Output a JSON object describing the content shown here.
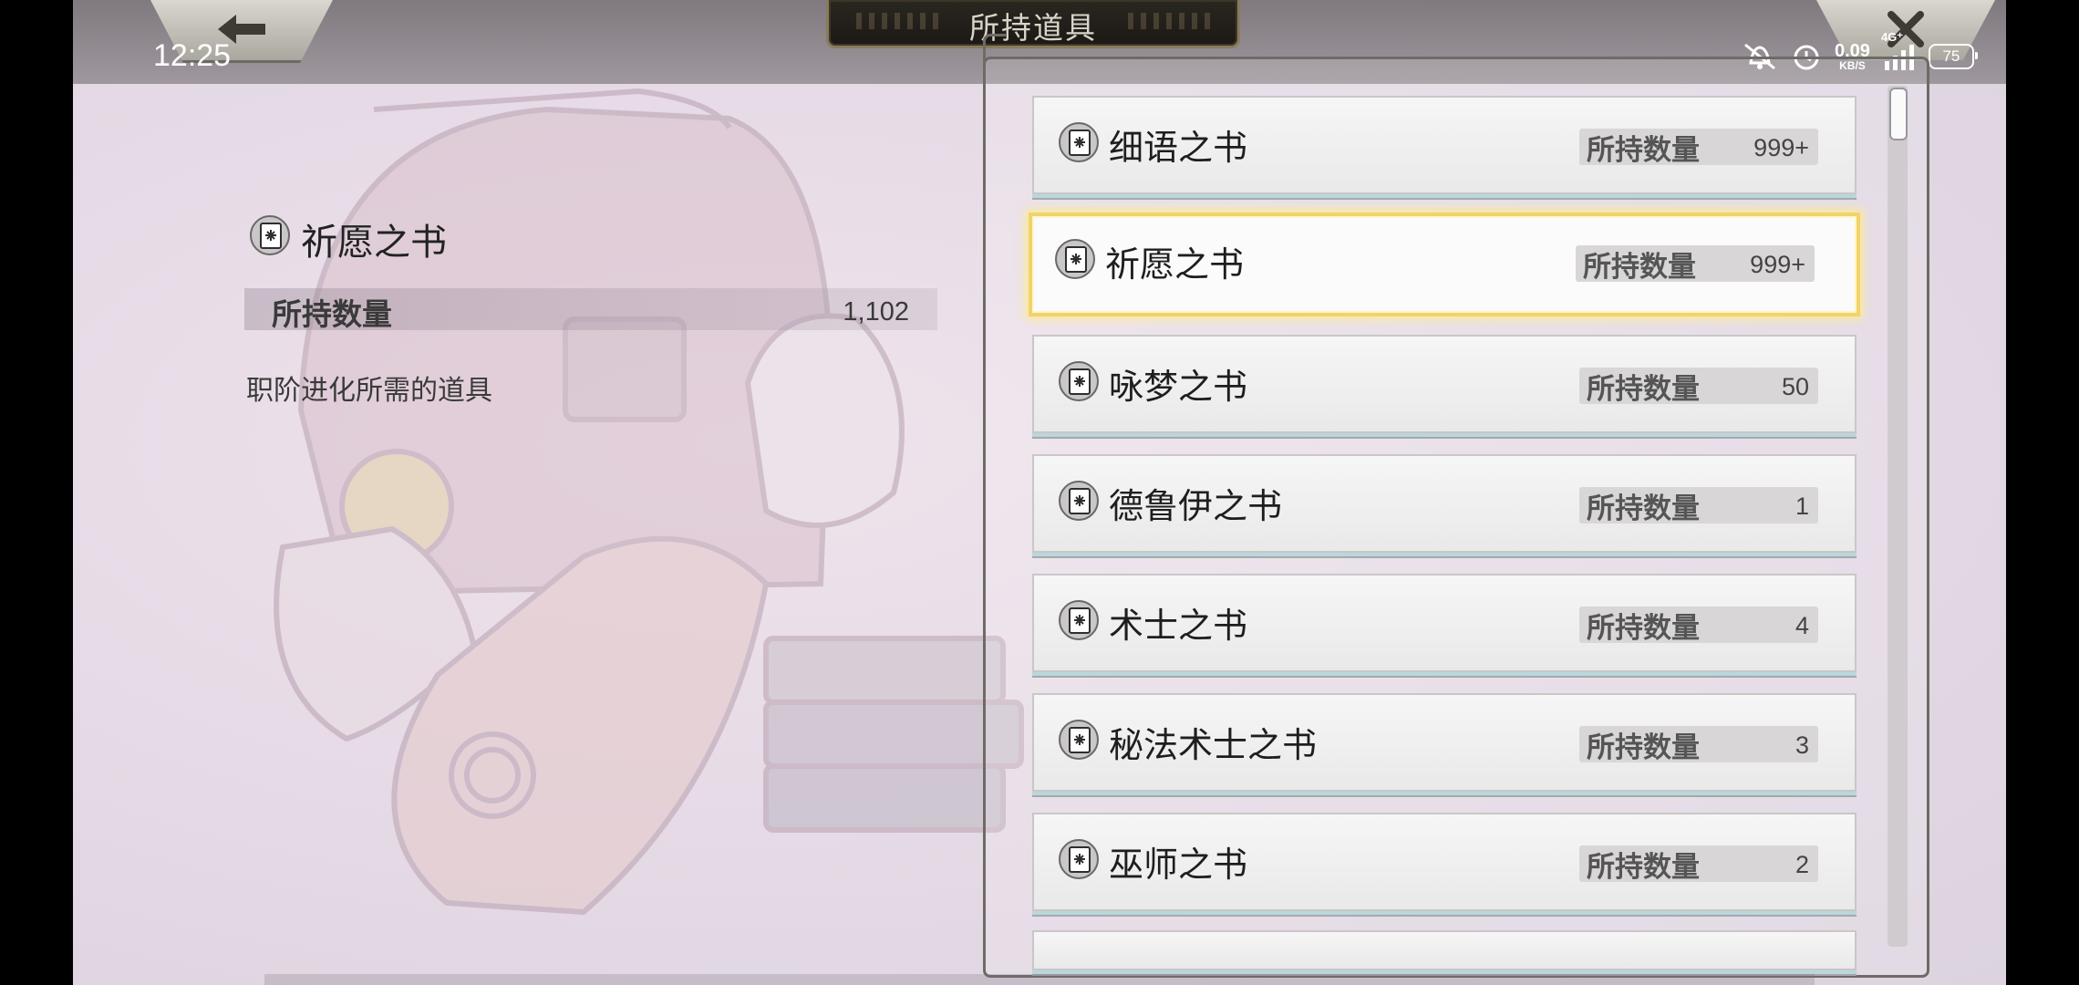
{
  "status_bar": {
    "time": "12:25",
    "net_speed": "0.09",
    "net_unit": "KB/S",
    "signal": "4G⁺",
    "battery": "75"
  },
  "header": {
    "title": "所持道具",
    "back_icon": "arrow-left-icon",
    "close_icon": "close-icon"
  },
  "detail": {
    "name": "祈愿之书",
    "qty_label": "所持数量",
    "qty_value": "1,102",
    "description": "职阶进化所需的道具"
  },
  "list": {
    "qty_label": "所持数量",
    "items": [
      {
        "name": "细语之书",
        "qty": "999+",
        "selected": false
      },
      {
        "name": "祈愿之书",
        "qty": "999+",
        "selected": true
      },
      {
        "name": "咏梦之书",
        "qty": "50",
        "selected": false
      },
      {
        "name": "德鲁伊之书",
        "qty": "1",
        "selected": false
      },
      {
        "name": "术士之书",
        "qty": "4",
        "selected": false
      },
      {
        "name": "秘法术士之书",
        "qty": "3",
        "selected": false
      },
      {
        "name": "巫师之书",
        "qty": "2",
        "selected": false
      }
    ]
  },
  "colors": {
    "selected_border": "#f0d36a",
    "title_plate": "#1c1915",
    "qty_box": "#d9d6d8"
  }
}
